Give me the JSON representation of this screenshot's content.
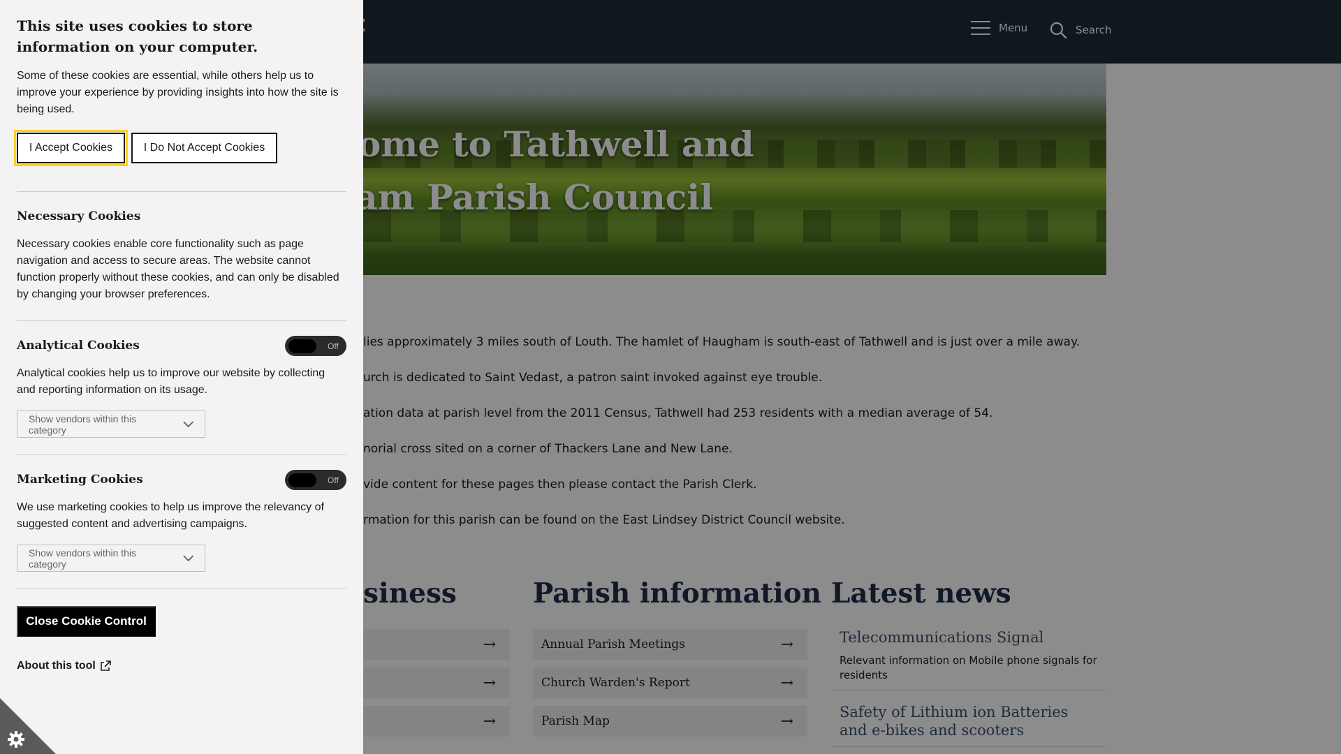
{
  "header": {
    "logo_fragment": "E",
    "menu_label": "Menu",
    "search_label": "Search"
  },
  "hero": {
    "title_line1": "ome to Tathwell and",
    "title_line2": "ham Parish Council"
  },
  "intro": {
    "paragraphs": [
      "lies approximately 3 miles south of Louth. The hamlet of Haugham is south-east of Tathwell and is just over a mile away.",
      "urch is dedicated to Saint Vedast, a patron saint invoked against eye trouble.",
      "ation data at parish level from the 2011 Census, Tathwell had 253 residents with a median average of 54.",
      "norial cross sited on a corner of Thackers Lane and New Lane.",
      "vide content for these pages then please contact the Parish Clerk.",
      "rmation for this parish can be found on the East Lindsey District Council website."
    ]
  },
  "columns": {
    "business_heading": "siness",
    "parish_heading": "Parish information",
    "news_heading": "Latest news",
    "parish_links": [
      "Annual Parish Meetings",
      "Church Warden's Report",
      "Parish Map"
    ],
    "news": [
      {
        "title": "Telecommunications Signal",
        "desc": "Relevant information on Mobile phone signals for residents"
      },
      {
        "title": "Safety of Lithium ion Batteries and e-bikes and scooters",
        "desc": ""
      }
    ]
  },
  "cookie": {
    "title": "This site uses cookies to store information on your computer.",
    "intro": "Some of these cookies are essential, while others help us to improve your experience by providing insights into how the site is being used.",
    "accept_label": "I Accept Cookies",
    "reject_label": "I Do Not Accept Cookies",
    "necessary_title": "Necessary Cookies",
    "necessary_text": "Necessary cookies enable core functionality such as page navigation and access to secure areas. The website cannot function properly without these cookies, and can only be disabled by changing your browser preferences.",
    "analytical_title": "Analytical Cookies",
    "analytical_toggle": "Off",
    "analytical_text": "Analytical cookies help us to improve our website by collecting and reporting information on its usage.",
    "vendors_label": "Show vendors within this category",
    "marketing_title": "Marketing Cookies",
    "marketing_toggle": "Off",
    "marketing_text": "We use marketing cookies to help us improve the relevancy of suggested content and advertising campaigns.",
    "close_label": "Close Cookie Control",
    "about_label": "About this tool"
  },
  "colors": {
    "header_bg": "#1e2a36",
    "panel_bg": "#f3f3f3",
    "focus_outline": "#ffd21f",
    "heading": "#1f2d4a"
  }
}
